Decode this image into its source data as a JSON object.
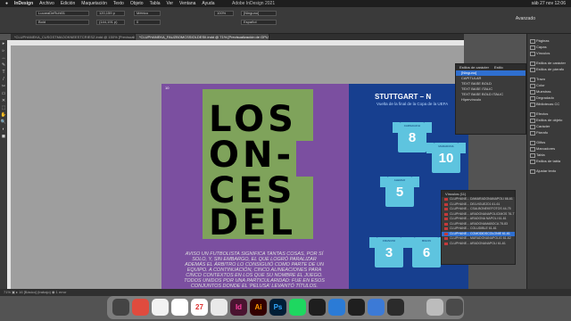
{
  "menubar": {
    "app": "InDesign",
    "items": [
      "Archivo",
      "Edición",
      "Maquetación",
      "Texto",
      "Objeto",
      "Tabla",
      "Ver",
      "Ventana",
      "Ayuda"
    ],
    "title": "Adobe InDesign 2021",
    "clock": "sáb 27 nov 12:06"
  },
  "ctrl": {
    "font": "LucaraDeRuhl01",
    "style": "Bold",
    "size": "120,159 p",
    "leading": "(144,191 p)",
    "tracking": "Métrico",
    "kerning": "0",
    "stylebox": "[Ninguno]",
    "language": "Español",
    "zoom": "100%",
    "avanzado": "Avanzado"
  },
  "tabs": [
    {
      "label": "*CLUPHANEKA_CUSGSTMAOOKNEESTCRIESZ.indd @ 150% [Previsualización]"
    },
    {
      "label": "*CLUPHANEKA_FAUZBOMCSSIOLDESII.indd @ 71% [Previsualización de GPU]"
    }
  ],
  "tools": [
    "▸",
    "▹",
    "↔",
    "✎",
    "T",
    "/",
    "✂",
    "▭",
    "✕",
    "⬚",
    "✋",
    "🔍",
    "◐",
    "◼"
  ],
  "doc": {
    "folio_left": "10",
    "big": [
      "LOS",
      "ON-",
      "CES",
      "DEL"
    ],
    "body": "AVISO UN FUTBOLISTA SIGNIFICA TANTAS COSAS, POR SÍ SOLO, Y, SIN EMBARGO, EL QUE LOGRÓ PARALIZAR ADEMÁS EL ÁRBITRO LO CONSIGUIÓ COMO PARTE DE UN EQUIPO. A CONTINUACIÓN, CINCO ALINEACIONES PARA CINCO CONTEXTOS EN LOS QUE SU NOMBRE EL JUEGO. TODOS UNIDOS POR UNA PARTICULARIDAD: FUE EN ESOS CONJUNTOS DONDE EL 'PELUSA' LEVANTÓ TÍTULOS.",
    "stuttgart": "STUTTGART – N",
    "subtitle": "Vuelta de la final de la Copa de la UEFA",
    "jerseys": [
      {
        "num": "8",
        "name": "CARNAGIOLI"
      },
      {
        "num": "10",
        "name": "MARADONA"
      },
      {
        "num": "5",
        "name": "ALEMAO"
      },
      {
        "num": "3",
        "name": "FRANCINI"
      },
      {
        "num": "6",
        "name": "BIGON"
      }
    ]
  },
  "charpanel": {
    "tabs": [
      "Estilos de carácter",
      "Estilo"
    ],
    "items": [
      "[Ninguno]",
      "CAPITULAR",
      "TEXT BASE BOLD",
      "TEXT BASE ITALIC",
      "TEXT BASE BOLD ITALIC",
      "Hipervínculo"
    ],
    "selected": 0
  },
  "linkpanel": {
    "title": "Vínculos (11)",
    "rows": [
      "CLUPHANE... DAMARADONANAPOLI 66-61",
      "CLUPHANE... DELVIGUEZ01 61-61",
      "CLUPHANE... CSALBONEKEFOTOS 44-75",
      "CLUPHANE... ARADONANAPOLICIMOS 76-77",
      "CLUPHANE... ARADONA NAPOLI 61-61",
      "CLUPHANE... ARADONAMABOCA 78-83",
      "CLUPHANE... COLUDIBLE 61-61",
      "CLUPHANE... COMODIDSCOLONIE 61-61",
      "CLUPHANE... MARADONANAPOLIG 61-62",
      "CLUPHANE... ARADONANAPOLI 61-61"
    ],
    "selected": 7
  },
  "dock": {
    "group1": [
      "Páginas",
      "Capas",
      "Vínculos"
    ],
    "group2": [
      "Estilos de carácter",
      "Estilos de párrafo"
    ],
    "group3": [
      "Trazo",
      "Color",
      "Muestras",
      "Degradado",
      "Bibliotecas CC"
    ],
    "group4": [
      "Efectos",
      "Estilos de objeto",
      "Carácter",
      "Párrafo"
    ],
    "group5": [
      "Glifos",
      "Marcadores",
      "Tabla",
      "Estilos de tabla"
    ],
    "group6": [
      "Ajustar texto"
    ]
  },
  "status": {
    "text": "71%   ▣ ▸  16   [Básico] (trabajo)   ◉ 1 error"
  },
  "apps": [
    {
      "label": "",
      "color": "#444"
    },
    {
      "label": "",
      "color": "#e04b3e"
    },
    {
      "label": "",
      "color": "#f2f2f2"
    },
    {
      "label": "",
      "color": "#ffffff"
    },
    {
      "label": "27",
      "color": "#ffffff"
    },
    {
      "label": "",
      "color": "#e9e9e9"
    },
    {
      "label": "Id",
      "color": "#4a1430"
    },
    {
      "label": "Ai",
      "color": "#330000"
    },
    {
      "label": "Ps",
      "color": "#001e36"
    },
    {
      "label": "",
      "color": "#1ed760"
    },
    {
      "label": "",
      "color": "#1e1e1e"
    },
    {
      "label": "",
      "color": "#2b7bd6"
    },
    {
      "label": "",
      "color": "#1f1f1f"
    },
    {
      "label": "",
      "color": "#3c7ad6"
    },
    {
      "label": "",
      "color": "#2b2b2b"
    },
    {
      "label": "",
      "color": "#bcbcbc"
    },
    {
      "label": "",
      "color": "#4a4a4a"
    }
  ]
}
